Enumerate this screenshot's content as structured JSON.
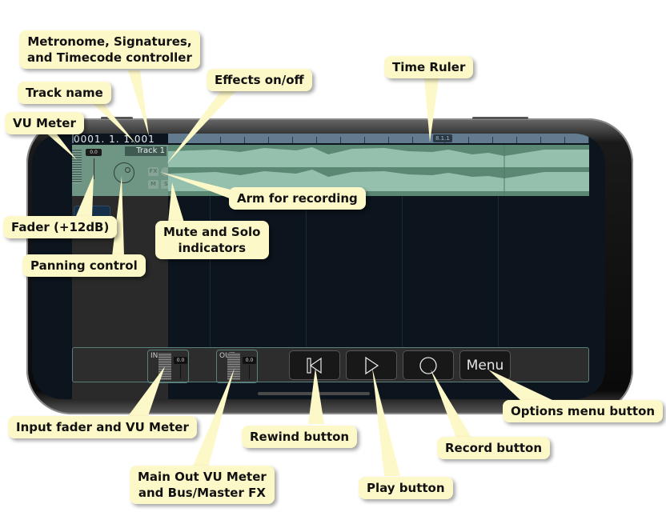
{
  "app": {
    "timecode": "0001. 1. 1.001",
    "track": {
      "name": "Track 1",
      "fader_value": "0.0",
      "fx_label": "FX",
      "mute_label": "M",
      "solo_label": "S"
    },
    "ruler": {
      "marker_label": "8.1.1"
    },
    "bottom_bar": {
      "input": {
        "label": "IN",
        "value": "0.0"
      },
      "output": {
        "label": "OUT",
        "value": "0.0"
      },
      "buttons": {
        "rewind": "rewind-icon",
        "play": "play-icon",
        "record": "record-icon",
        "menu_label": "Menu"
      }
    }
  },
  "callouts": {
    "metronome": [
      "Metronome, Signatures,",
      "and Timecode controller"
    ],
    "track_name": "Track name",
    "vu_meter": "VU Meter",
    "effects": "Effects on/off",
    "time_ruler": "Time Ruler",
    "arm": "Arm for recording",
    "fader": "Fader (+12dB)",
    "mute_solo": [
      "Mute and Solo",
      "indicators"
    ],
    "panning": "Panning control",
    "input_fader": "Input fader and VU Meter",
    "main_out": [
      "Main Out VU Meter",
      "and Bus/Master FX"
    ],
    "rewind": "Rewind button",
    "play": "Play button",
    "record": "Record button",
    "options_menu": "Options menu button"
  },
  "colors": {
    "callout_bg": "#fdf8c8",
    "waveform": "#5a8873",
    "ruler": "#627b8e",
    "screen_bg": "#0c141d"
  }
}
